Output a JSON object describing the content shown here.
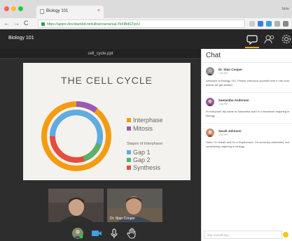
{
  "browser": {
    "tab_title": "Biology 101",
    "tab_close": "×",
    "user_label": "Note",
    "url": "https://appre.dev.blackbd.net/ultra/course/uuLYkFtBdGTpcU"
  },
  "app": {
    "title": "Biology 101"
  },
  "presentation": {
    "filename": "cell_cycle.ppt"
  },
  "slide": {
    "title": "THE CELL CYCLE",
    "legend": [
      {
        "label": "Interphase",
        "color": "#f39c12"
      },
      {
        "label": "Mitosis",
        "color": "#9b59b6"
      }
    ],
    "stages_title": "Stages of Interphase:",
    "stages": [
      {
        "label": "Gap 1",
        "color": "#5dade2"
      },
      {
        "label": "Gap 2",
        "color": "#58b368"
      },
      {
        "label": "Synthesis",
        "color": "#e74c3c"
      }
    ]
  },
  "participants": [
    {
      "name": ""
    },
    {
      "name": "Dr. Stan Cooper"
    }
  ],
  "chat": {
    "title": "Chat",
    "messages": [
      {
        "name": "Dr. Stan Cooper",
        "time": "1:55 PM",
        "text": "Welcome to Biology 101. Please introduce yourself here in the chat before we get started."
      },
      {
        "name": "Samantha Anderson",
        "time": "1:56 PM",
        "text": "Hi everyone! My name is Samantha and I'm a freshman majoring in biology."
      },
      {
        "name": "Sarah Johnson",
        "time": "1:56 PM",
        "text": "Hello, I'm Sarah and I'm a Sophomore. I'm currently undecided, but considering majoring in biology."
      }
    ],
    "input_placeholder": "Say something..."
  },
  "colors": {
    "accent": "#f5a623",
    "header_bg": "#262626",
    "main_bg": "#2d2d2d"
  }
}
